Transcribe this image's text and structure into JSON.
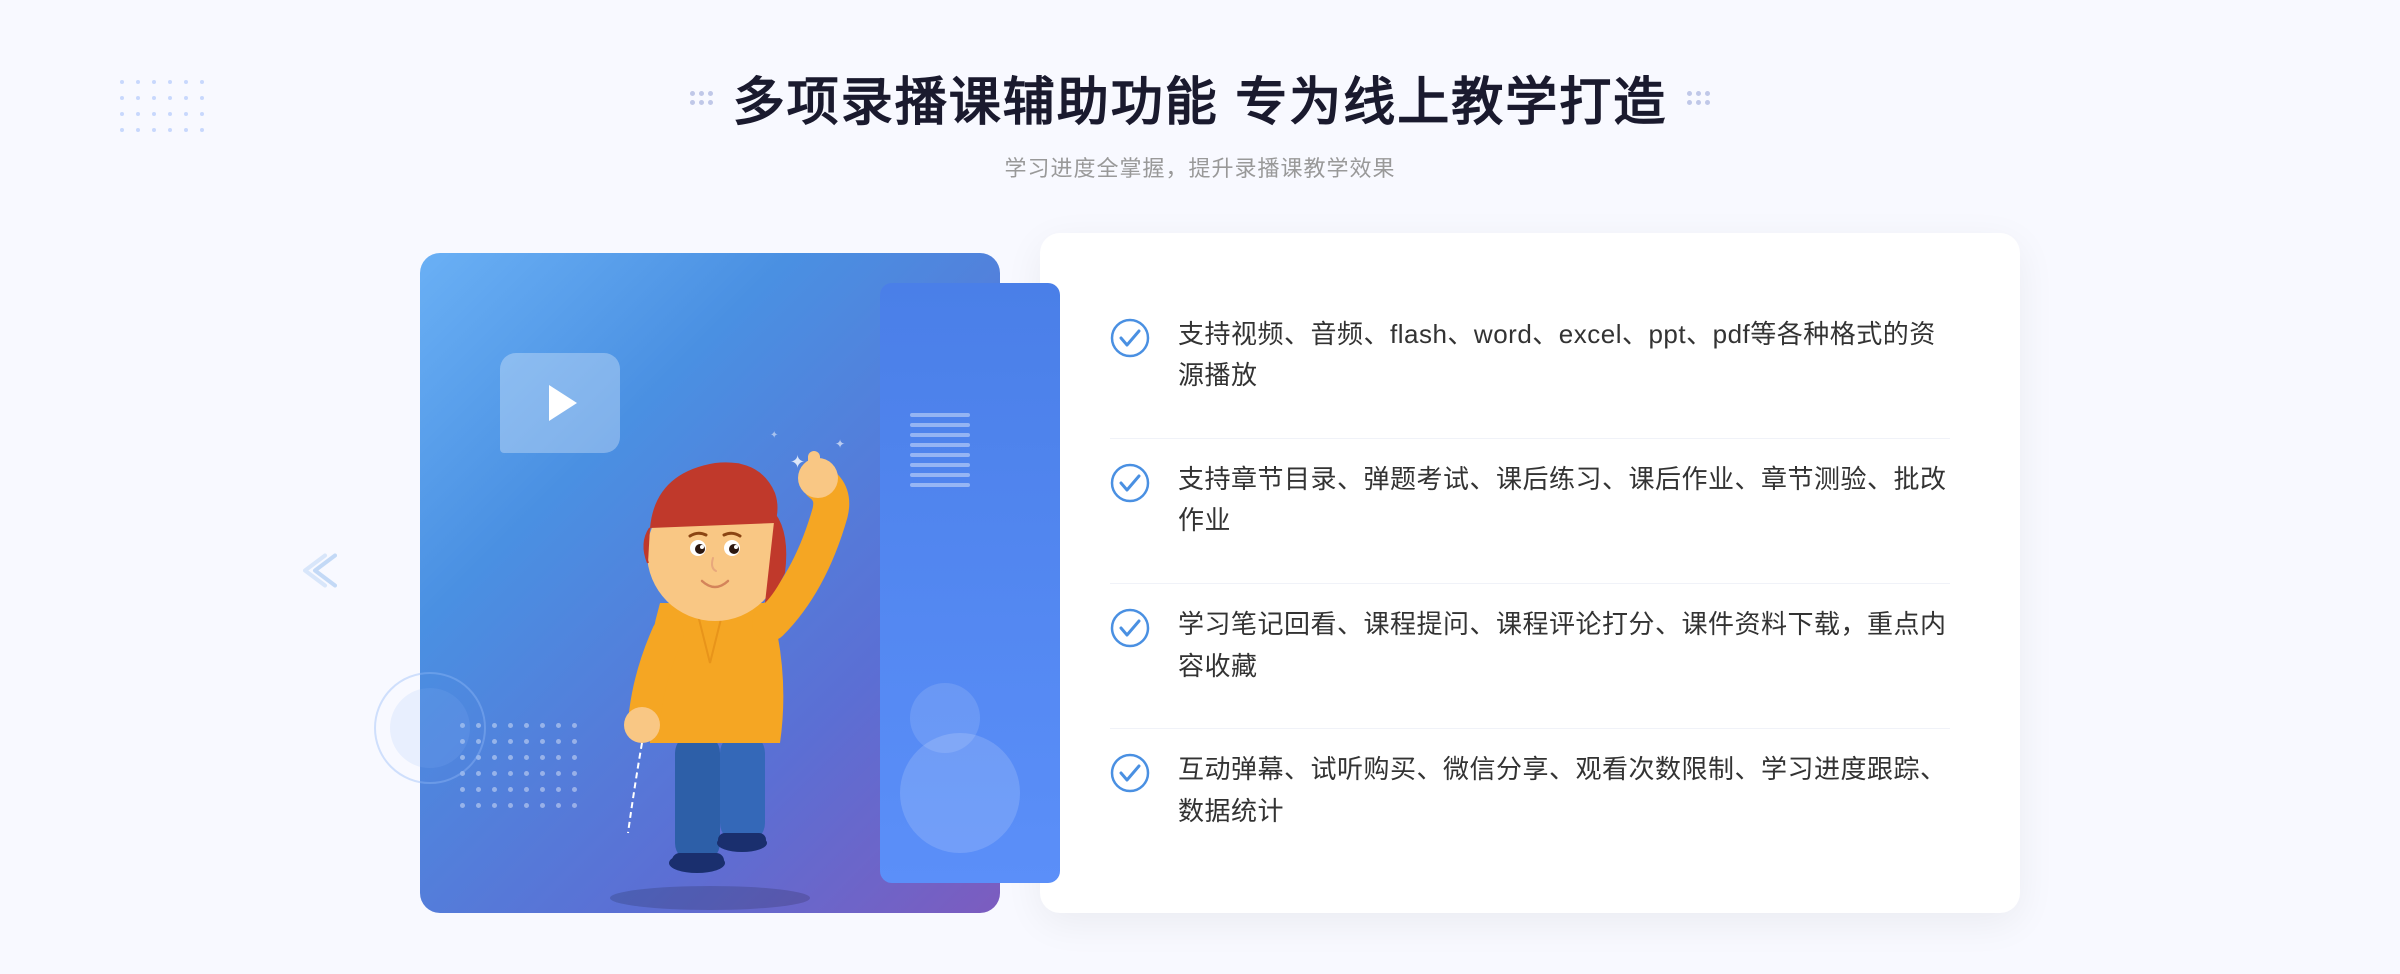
{
  "header": {
    "title": "多项录播课辅助功能 专为线上教学打造",
    "subtitle": "学习进度全掌握，提升录播课教学效果"
  },
  "features": [
    {
      "id": "feature-1",
      "text": "支持视频、音频、flash、word、excel、ppt、pdf等各种格式的资源播放"
    },
    {
      "id": "feature-2",
      "text": "支持章节目录、弹题考试、课后练习、课后作业、章节测验、批改作业"
    },
    {
      "id": "feature-3",
      "text": "学习笔记回看、课程提问、课程评论打分、课件资料下载，重点内容收藏"
    },
    {
      "id": "feature-4",
      "text": "互动弹幕、试听购买、微信分享、观看次数限制、学习进度跟踪、数据统计"
    }
  ],
  "colors": {
    "primary": "#4a90e2",
    "gradient_start": "#6ab0f5",
    "gradient_end": "#7c5cbf",
    "title_color": "#1a1a2e",
    "text_color": "#333333",
    "subtitle_color": "#999999",
    "check_color": "#4a90e2"
  }
}
